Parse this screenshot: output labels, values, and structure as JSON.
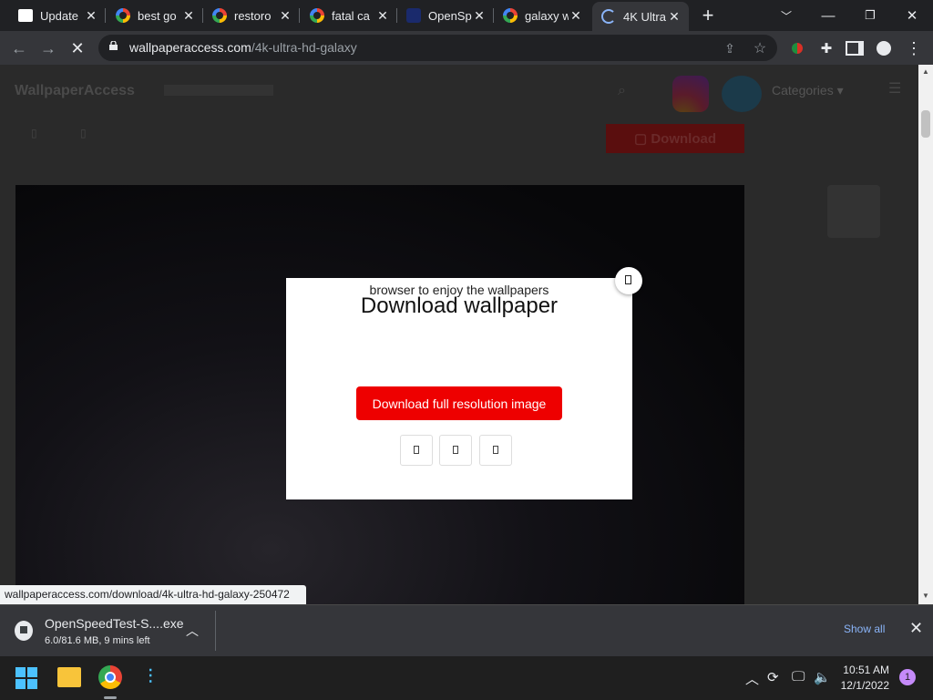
{
  "browser": {
    "tabs": [
      {
        "title": "Update",
        "favicon": "ps-favicon"
      },
      {
        "title": "best go",
        "favicon": "google-favicon"
      },
      {
        "title": "restoro",
        "favicon": "google-favicon"
      },
      {
        "title": "fatal ca",
        "favicon": "google-favicon"
      },
      {
        "title": "OpenSp",
        "favicon": "openspeedtest-favicon"
      },
      {
        "title": "galaxy w",
        "favicon": "google-favicon"
      },
      {
        "title": "4K Ultra",
        "favicon": "loading-spinner"
      }
    ],
    "url_host": "wallpaperaccess.com",
    "url_path": "/4k-ultra-hd-galaxy"
  },
  "site": {
    "logo": "WallpaperAccess",
    "categories_label": "Categories",
    "download_button": "Download"
  },
  "modal": {
    "subtitle": "browser to enjoy the wallpapers",
    "title": "Download wallpaper",
    "button": "Download full resolution image"
  },
  "status_bar": {
    "url": "wallpaperaccess.com/download/4k-ultra-hd-galaxy-250472"
  },
  "download_bar": {
    "file_name": "OpenSpeedTest-S....exe",
    "progress": "6.0/81.6 MB, 9 mins left",
    "show_all": "Show all"
  },
  "taskbar": {
    "time": "10:51 AM",
    "date": "12/1/2022",
    "notifications": "1"
  },
  "colors": {
    "accent_red": "#ee0000",
    "link_blue": "#8ab4f8",
    "chrome_dark": "#202124",
    "toolbar": "#35363a"
  }
}
